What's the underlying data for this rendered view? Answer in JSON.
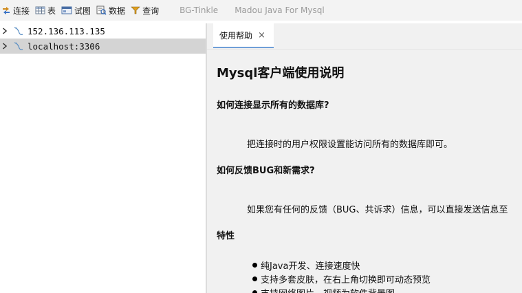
{
  "toolbar": {
    "items": [
      {
        "label": "连接",
        "icon": "connect-icon"
      },
      {
        "label": "表",
        "icon": "table-icon"
      },
      {
        "label": "试图",
        "icon": "view-icon"
      },
      {
        "label": "数据",
        "icon": "data-icon"
      },
      {
        "label": "查询",
        "icon": "query-icon"
      }
    ],
    "links": [
      "BG-Tinkle",
      "Madou Java For Mysql"
    ]
  },
  "tree": {
    "connections": [
      {
        "label": "152.136.113.135",
        "selected": false
      },
      {
        "label": "localhost:3306",
        "selected": true
      }
    ]
  },
  "tabs": [
    {
      "label": "使用帮助",
      "close": "×"
    }
  ],
  "doc": {
    "title": "Mysql客户端使用说明",
    "sections": [
      {
        "heading": "如何连接显示所有的数据库?",
        "text": "把连接时的用户权限设置能访问所有的数据库即可。"
      },
      {
        "heading": "如何反馈BUG和新需求?",
        "text": "如果您有任何的反馈（BUG、共诉求）信息，可以直接发送信息至"
      },
      {
        "heading": "特性"
      }
    ],
    "features": [
      "纯Java开发、连接速度快",
      "支持多套皮肤，在右上角切换即可动态预览",
      "支持网络图片、视频为软件背景图"
    ]
  },
  "colors": {
    "toolbar_bg": "#f3f3f3",
    "selection": "#d4d4d4",
    "tab_accent": "#6f9fd8",
    "link_gray": "#9a9a9a"
  }
}
